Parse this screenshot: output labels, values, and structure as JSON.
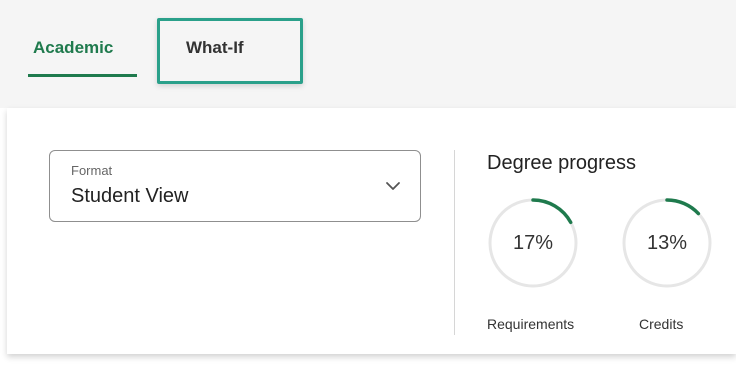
{
  "tabs": [
    {
      "label": "Academic",
      "active": true
    },
    {
      "label": "What-If",
      "active": false
    }
  ],
  "format": {
    "label": "Format",
    "value": "Student View"
  },
  "degree_progress": {
    "title": "Degree progress",
    "metrics": [
      {
        "label": "Requirements",
        "percent_text": "17%",
        "value": 0.17
      },
      {
        "label": "Credits",
        "percent_text": "13%",
        "value": 0.13
      }
    ]
  },
  "colors": {
    "accent": "#1f7a4d",
    "focus": "#2aa08a",
    "track": "#e6e6e6"
  }
}
